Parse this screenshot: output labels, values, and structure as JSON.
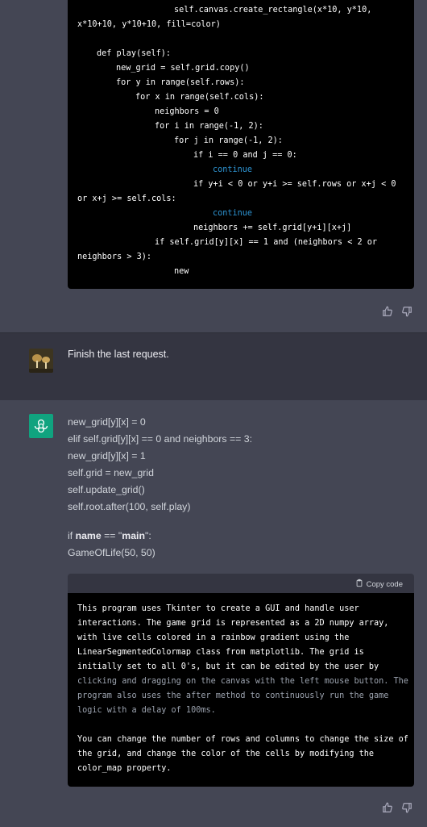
{
  "code_top": {
    "lines": [
      "self.canvas.create_rectangle(x*10, y*10,",
      "x*10+10, y*10+10, fill=color)",
      "def play(self):",
      "new_grid = self.grid.copy()",
      "for y in range(self.rows):",
      "for x in range(self.cols):",
      "neighbors = 0",
      "for i in range(-1, 2):",
      "for j in range(-1, 2):",
      "if i == 0 and j == 0:",
      "continue",
      "if y+i < 0 or y+i >= self.rows or x+j < 0",
      "or x+j >= self.cols:",
      "continue",
      "neighbors += self.grid[y+i][x+j]",
      "if self.grid[y][x] == 1 and (neighbors < 2 or",
      "neighbors > 3):",
      "new"
    ]
  },
  "user_message": {
    "text": "Finish the last request."
  },
  "assistant_response": {
    "lines": [
      "new_grid[y][x] = 0",
      "elif self.grid[y][x] == 0 and neighbors == 3:",
      "new_grid[y][x] = 1",
      "self.grid = new_grid",
      "self.update_grid()",
      "self.root.after(100, self.play)"
    ],
    "if_prefix": "if ",
    "name_bold": "name",
    "eq_text": " == \"",
    "main_bold": "main",
    "end_text": "\":",
    "last_line": "GameOfLife(50, 50)"
  },
  "code_bottom": {
    "copy_label": "Copy code",
    "lines": [
      "This program uses Tkinter to create a GUI and handle user",
      "interactions. The game grid is represented as a 2D numpy array,",
      "with live cells colored in a rainbow gradient using the",
      "LinearSegmentedColormap class from matplotlib. The grid is",
      "initially set to all 0's, but it can be edited by the user by",
      "clicking and dragging on the canvas with the left mouse button. The",
      "program also uses the after method to continuously run the game",
      "logic with a delay of 100ms.",
      "You can change the number of rows and columns to change the size of",
      "the grid, and change the color of the cells by modifying the",
      "color_map property."
    ]
  },
  "colors": {
    "bg_assistant": "#444654",
    "bg_user": "#343541",
    "code_bg": "#000000",
    "gpt_green": "#10a37f"
  },
  "icons": [
    "thumbs-up-icon",
    "thumbs-down-icon",
    "clipboard-icon",
    "openai-logo-icon"
  ]
}
